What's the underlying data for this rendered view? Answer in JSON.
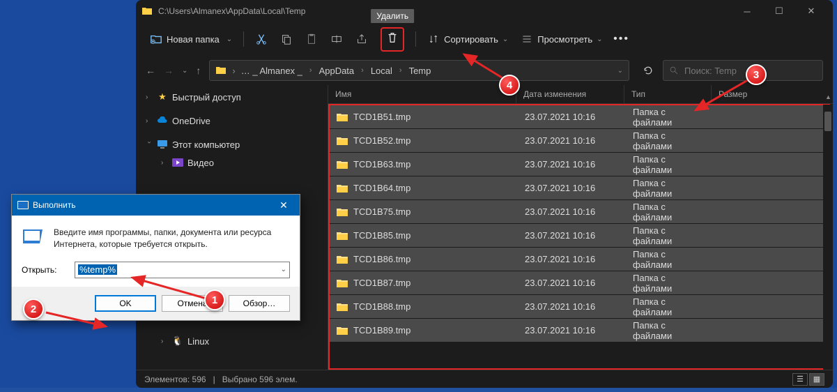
{
  "window": {
    "title": "C:\\Users\\Almanex\\AppData\\Local\\Temp"
  },
  "toolbar": {
    "new_folder": "Новая папка",
    "delete_tooltip": "Удалить",
    "sort": "Сортировать",
    "view": "Просмотреть"
  },
  "address": {
    "crumbs": [
      "… _ Almanex _",
      "AppData",
      "Local",
      "Temp"
    ]
  },
  "search": {
    "placeholder": "Поиск: Temp"
  },
  "sidebar": {
    "items": [
      {
        "label": "Быстрый доступ",
        "icon": "star"
      },
      {
        "label": "OneDrive",
        "icon": "cloud"
      },
      {
        "label": "Этот компьютер",
        "icon": "pc"
      },
      {
        "label": "Видео",
        "icon": "video",
        "nested": true
      },
      {
        "label": "Linux",
        "icon": "linux",
        "nested": true
      }
    ]
  },
  "columns": {
    "name": "Имя",
    "date": "Дата изменения",
    "type": "Тип",
    "size": "Размер"
  },
  "rows": [
    {
      "name": "TCD1B51.tmp",
      "date": "23.07.2021 10:16",
      "type": "Папка с файлами"
    },
    {
      "name": "TCD1B52.tmp",
      "date": "23.07.2021 10:16",
      "type": "Папка с файлами"
    },
    {
      "name": "TCD1B63.tmp",
      "date": "23.07.2021 10:16",
      "type": "Папка с файлами"
    },
    {
      "name": "TCD1B64.tmp",
      "date": "23.07.2021 10:16",
      "type": "Папка с файлами"
    },
    {
      "name": "TCD1B75.tmp",
      "date": "23.07.2021 10:16",
      "type": "Папка с файлами"
    },
    {
      "name": "TCD1B85.tmp",
      "date": "23.07.2021 10:16",
      "type": "Папка с файлами"
    },
    {
      "name": "TCD1B86.tmp",
      "date": "23.07.2021 10:16",
      "type": "Папка с файлами"
    },
    {
      "name": "TCD1B87.tmp",
      "date": "23.07.2021 10:16",
      "type": "Папка с файлами"
    },
    {
      "name": "TCD1B88.tmp",
      "date": "23.07.2021 10:16",
      "type": "Папка с файлами"
    },
    {
      "name": "TCD1B89.tmp",
      "date": "23.07.2021 10:16",
      "type": "Папка с файлами"
    }
  ],
  "status": {
    "elements": "Элементов: 596",
    "selected": "Выбрано 596 элем."
  },
  "run": {
    "title": "Выполнить",
    "text": "Введите имя программы, папки, документа или ресурса Интернета, которые требуется открыть.",
    "label": "Открыть:",
    "value": "%temp%",
    "ok": "OK",
    "cancel": "Отмена",
    "browse": "Обзор…"
  },
  "annotations": {
    "1": "1",
    "2": "2",
    "3": "3",
    "4": "4"
  }
}
